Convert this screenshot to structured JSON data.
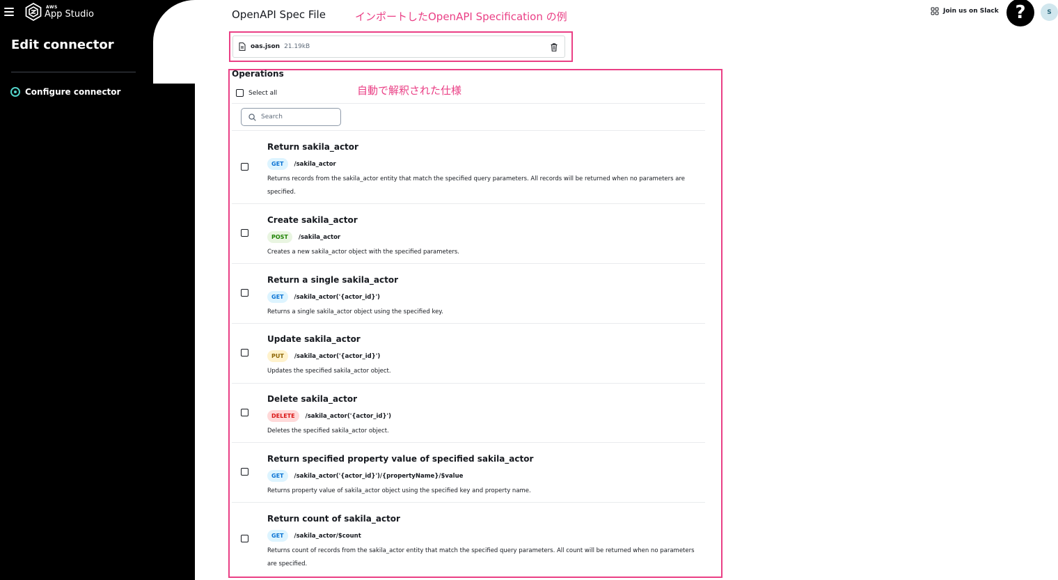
{
  "app": {
    "brand_small": "AWS",
    "brand": "App Studio",
    "page_heading": "Edit connector",
    "nav_steps": [
      {
        "label": "Configure connector",
        "active": true
      }
    ],
    "accent_color": "#53d3c9"
  },
  "header": {
    "slack_label": "Join us on Slack",
    "help_label": "?",
    "avatar_initial": "S"
  },
  "annotations": {
    "spec_file": "インポートしたOpenAPI Specification の例",
    "operations": "自動で解釈された仕様",
    "color": "#ea3f85"
  },
  "spec_file": {
    "title": "OpenAPI Spec File",
    "file_name": "oas.json",
    "file_size": "21.19kB"
  },
  "operations": {
    "title": "Operations",
    "select_all_label": "Select all",
    "search_placeholder": "Search",
    "items": [
      {
        "title": "Return sakila_actor",
        "method": "GET",
        "path": "/sakila_actor",
        "description": "Returns records from the sakila_actor entity that match the specified query parameters. All records will be returned when no parameters are specified."
      },
      {
        "title": "Create sakila_actor",
        "method": "POST",
        "path": "/sakila_actor",
        "description": "Creates a new sakila_actor object with the specified parameters."
      },
      {
        "title": "Return a single sakila_actor",
        "method": "GET",
        "path": "/sakila_actor('{actor_id}')",
        "description": "Returns a single sakila_actor object using the specified key."
      },
      {
        "title": "Update sakila_actor",
        "method": "PUT",
        "path": "/sakila_actor('{actor_id}')",
        "description": "Updates the specified sakila_actor object."
      },
      {
        "title": "Delete sakila_actor",
        "method": "DELETE",
        "path": "/sakila_actor('{actor_id}')",
        "description": "Deletes the specified sakila_actor object."
      },
      {
        "title": "Return specified property value of specified sakila_actor",
        "method": "GET",
        "path": "/sakila_actor('{actor_id}')/{propertyName}/$value",
        "description": "Returns property value of sakila_actor object using the specified key and property name."
      },
      {
        "title": "Return count of sakila_actor",
        "method": "GET",
        "path": "/sakila_actor/$count",
        "description": "Returns count of records from the sakila_actor entity that match the specified query parameters. All count will be returned when no parameters are specified."
      }
    ]
  }
}
